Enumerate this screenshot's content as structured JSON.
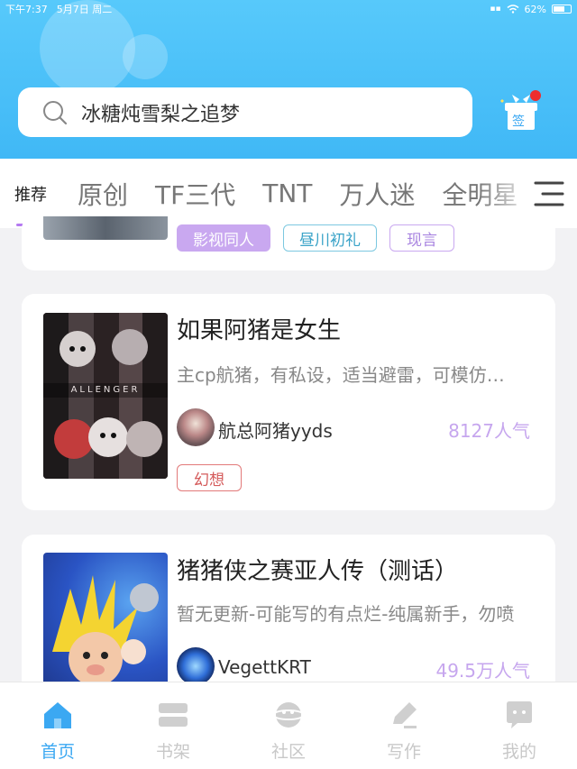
{
  "status_bar": {
    "time": "下午7:37",
    "date": "5月7日 周二",
    "battery": "62%"
  },
  "search": {
    "text": "冰糖炖雪梨之追梦"
  },
  "signin": {
    "label": "签"
  },
  "tabs": [
    {
      "label": "推荐",
      "active": true
    },
    {
      "label": "原创"
    },
    {
      "label": "TF三代"
    },
    {
      "label": "TNT"
    },
    {
      "label": "万人迷"
    },
    {
      "label": "全明星"
    }
  ],
  "top_card": {
    "tags": [
      {
        "label": "影视同人",
        "style": "filled-purple"
      },
      {
        "label": "昼川初礼",
        "style": "outline-teal"
      },
      {
        "label": "现言",
        "style": "outline-purple"
      }
    ]
  },
  "stories": [
    {
      "title": "如果阿猪是女生",
      "desc": "主cp航猪，有私设，适当避雷，可模仿…",
      "author": "航总阿猪yyds",
      "popularity": "8127人气",
      "tags": [
        {
          "label": "幻想",
          "style": "outline-red"
        }
      ],
      "cover_text": "ALLENGER"
    },
    {
      "title": "猪猪侠之赛亚人传（测话）",
      "desc": "暂无更新-可能写的有点烂-纯属新手，勿喷",
      "author": "VegettKRT",
      "popularity": "49.5万人气",
      "tags": []
    }
  ],
  "bottom_nav": [
    {
      "label": "首页",
      "icon": "home-icon",
      "active": true
    },
    {
      "label": "书架",
      "icon": "bookshelf-icon"
    },
    {
      "label": "社区",
      "icon": "planet-icon"
    },
    {
      "label": "写作",
      "icon": "pen-icon"
    },
    {
      "label": "我的",
      "icon": "chat-bubble-icon"
    }
  ],
  "colors": {
    "accent": "#3ba8f2",
    "header": "#4fc2fa",
    "tag_purple": "#c9a8f0",
    "popularity": "#c6a6ee",
    "tag_red": "#e27979"
  }
}
